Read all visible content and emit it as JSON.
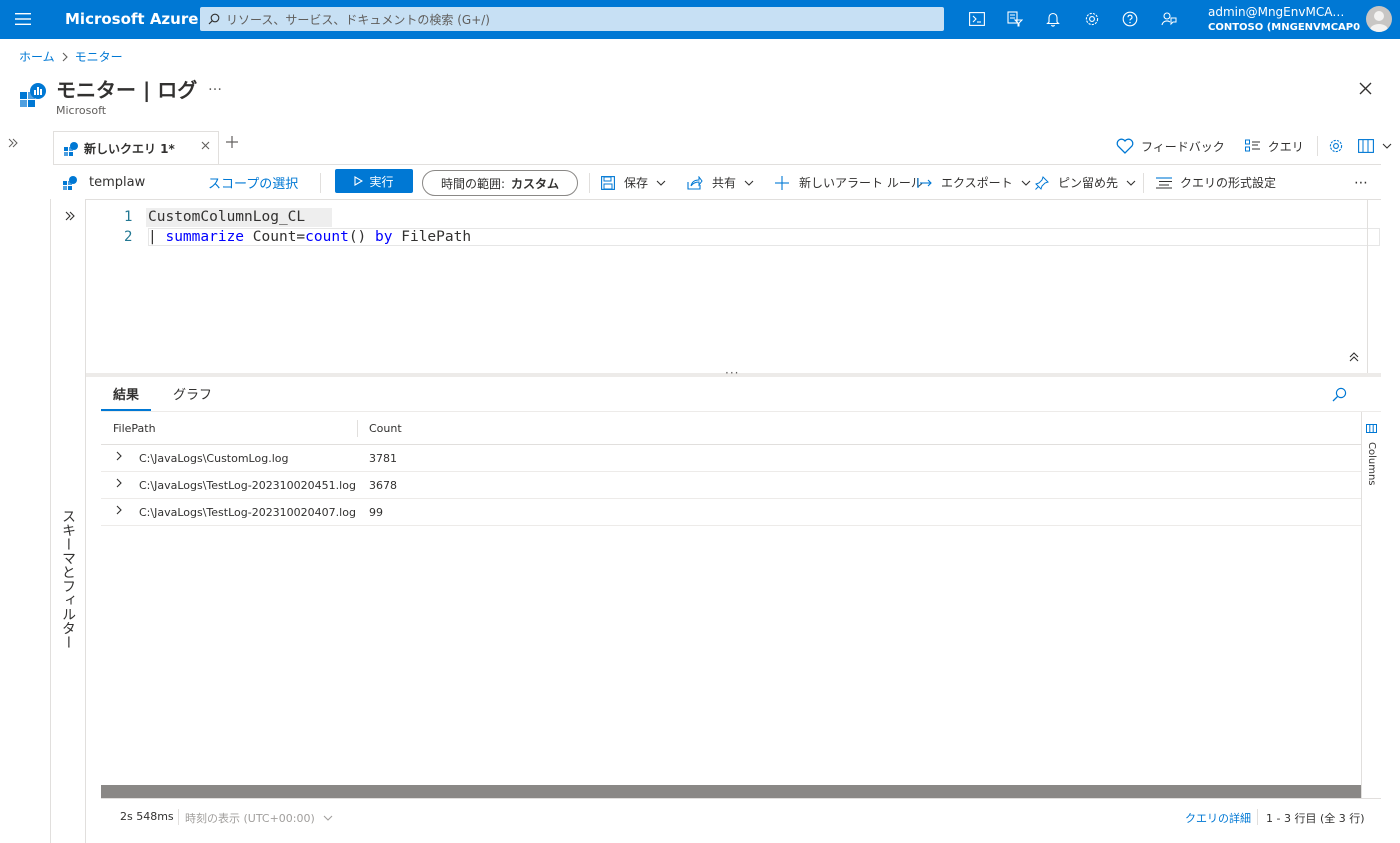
{
  "topbar": {
    "brand": "Microsoft Azure",
    "search_placeholder": "リソース、サービス、ドキュメントの検索 (G+/)",
    "account_user": "admin@MngEnvMCA…",
    "account_tenant": "CONTOSO (MNGENVMCAP0…",
    "icons": [
      "cloud-shell-icon",
      "directory-filter-icon",
      "notifications-icon",
      "settings-icon",
      "help-icon",
      "feedback-icon"
    ]
  },
  "breadcrumb": {
    "home": "ホーム",
    "current": "モニター"
  },
  "header": {
    "title": "モニター | ログ",
    "subtitle": "Microsoft",
    "more": "…"
  },
  "tabs": [
    {
      "label": "新しいクエリ 1*"
    }
  ],
  "right_tools": {
    "feedback": "フィードバック",
    "queries": "クエリ"
  },
  "commandbar": {
    "scope_name": "templaw",
    "scope_select": "スコープの選択",
    "run": "実行",
    "time_range_label": "時間の範囲:",
    "time_range_value": "カスタム",
    "save": "保存",
    "share": "共有",
    "new_alert": "新しいアラート ルール",
    "export": "エクスポート",
    "pin": "ピン留め先",
    "format": "クエリの形式設定",
    "more": "⋯"
  },
  "schema_panel": {
    "label": "スキーマとフィルター"
  },
  "editor": {
    "lines": [
      {
        "num": "1",
        "text": "CustomColumnLog_CL"
      },
      {
        "num": "2",
        "pipe": "|",
        "kw1": "summarize",
        "mid": "Count=",
        "kw2": "count",
        "paren": "()",
        "kw3": "by",
        "tail": "FilePath"
      }
    ]
  },
  "results": {
    "tabs": [
      "結果",
      "グラフ"
    ],
    "columns": [
      "FilePath",
      "Count"
    ],
    "rows": [
      {
        "path": "C:\\JavaLogs\\CustomLog.log",
        "count": "3781"
      },
      {
        "path": "C:\\JavaLogs\\TestLog-202310020451.log",
        "count": "3678"
      },
      {
        "path": "C:\\JavaLogs\\TestLog-202310020407.log",
        "count": "99"
      }
    ],
    "columns_panel": "Columns"
  },
  "status": {
    "duration": "2s 548ms",
    "timezone": "時刻の表示 (UTC+00:00)",
    "details": "クエリの詳細",
    "rows": "1 - 3 行目 (全 3 行)"
  },
  "colors": {
    "accent": "#0078d4",
    "search_bg": "#c7e0f4",
    "keyword": "#0000ff",
    "line_number": "#237893"
  }
}
